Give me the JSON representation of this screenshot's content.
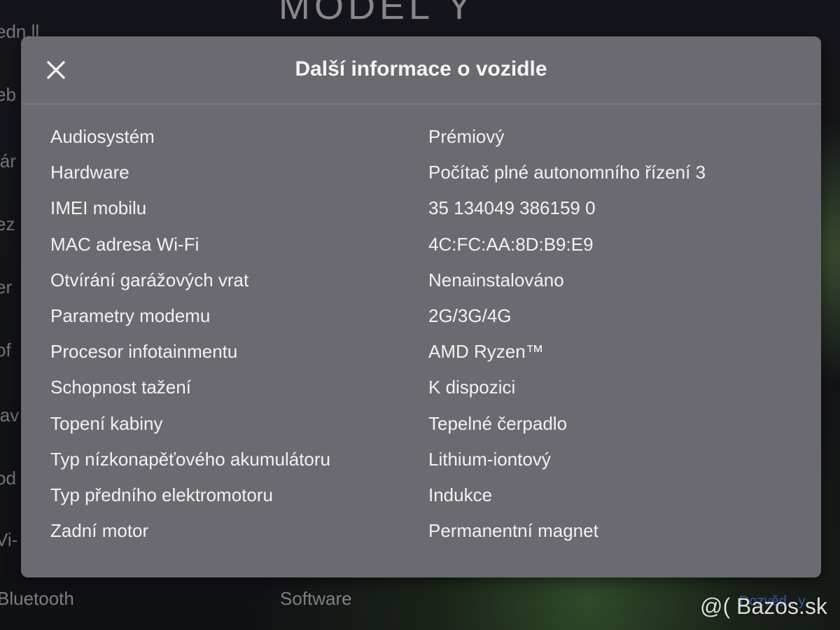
{
  "background": {
    "title": "MODEL Y",
    "side_fragments": [
      "edn.ll",
      "eb",
      "lár",
      "ez",
      "er",
      "of",
      "lav",
      "od",
      "Vi-"
    ],
    "bottom_left": "Bluetooth",
    "bottom_center": "Software",
    "bottom_right_link": "Dozvěd...y"
  },
  "watermark": "@( Bazos.sk",
  "modal": {
    "title": "Další informace o vozidle",
    "close_icon": "close-icon",
    "rows": [
      {
        "label": "Audiosystém",
        "value": "Prémiový"
      },
      {
        "label": "Hardware",
        "value": "Počítač plné autonomního řízení 3"
      },
      {
        "label": "IMEI mobilu",
        "value": "35 134049 386159 0"
      },
      {
        "label": "MAC adresa Wi-Fi",
        "value": "4C:FC:AA:8D:B9:E9"
      },
      {
        "label": "Otvírání garážových vrat",
        "value": "Nenainstalováno"
      },
      {
        "label": "Parametry modemu",
        "value": "2G/3G/4G"
      },
      {
        "label": "Procesor infotainmentu",
        "value": "AMD Ryzen™"
      },
      {
        "label": "Schopnost tažení",
        "value": "K dispozici"
      },
      {
        "label": "Topení kabiny",
        "value": "Tepelné čerpadlo"
      },
      {
        "label": "Typ nízkonapěťového akumulátoru",
        "value": "Lithium-iontový"
      },
      {
        "label": "Typ předního elektromotoru",
        "value": "Indukce"
      },
      {
        "label": "Zadní motor",
        "value": "Permanentní magnet"
      }
    ]
  }
}
